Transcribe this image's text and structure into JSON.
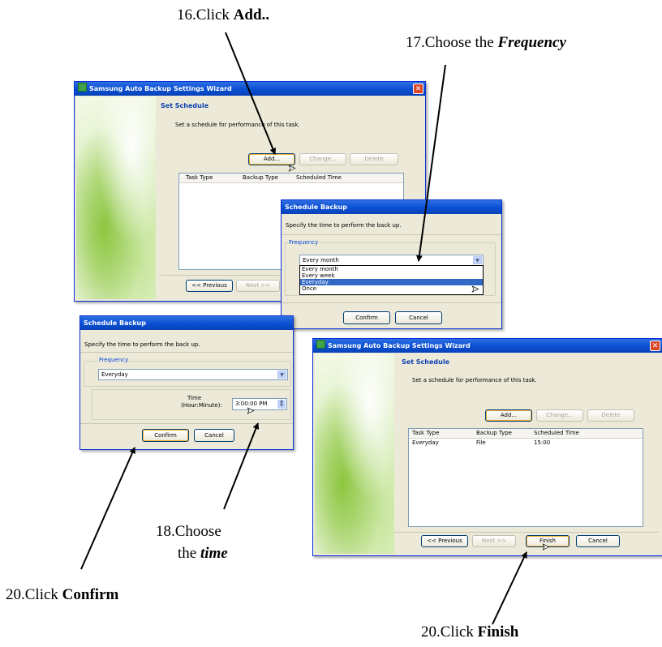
{
  "annotations": {
    "step16": {
      "prefix": "16.Click ",
      "bold": "Add.."
    },
    "step17": {
      "prefix": "17.Choose the ",
      "bold": "Frequency"
    },
    "step18_line1": "18.Choose",
    "step18_line2_prefix": "the ",
    "step18_bold": "time",
    "step20a": {
      "prefix": "20.Click ",
      "bold": "Confirm"
    },
    "step20b": {
      "prefix": "20.Click ",
      "bold": "Finish"
    }
  },
  "wizard1": {
    "title": "Samsung Auto Backup Settings Wizard",
    "heading": "Set Schedule",
    "instruction": "Set a schedule for performance of this task.",
    "buttons": {
      "add": "Add...",
      "change": "Change...",
      "delete": "Delete",
      "previous": "<< Previous",
      "next": "Next >>"
    },
    "columns": [
      "Task Type",
      "Backup Type",
      "Scheduled Time"
    ]
  },
  "schedule1": {
    "title": "Schedule Backup",
    "instruction": "Specify the time to perform the back up.",
    "frequency_label": "Frequency",
    "frequency_value": "Every month",
    "options": [
      "Every month",
      "Every week",
      "Everyday",
      "Once"
    ],
    "selected_option": "Everyday",
    "buttons": {
      "confirm": "Confirm",
      "cancel": "Cancel"
    }
  },
  "schedule2": {
    "title": "Schedule Backup",
    "instruction": "Specify the time to perform the back up.",
    "frequency_label": "Frequency",
    "frequency_value": "Everyday",
    "time_label_1": "Time",
    "time_label_2": "(Hour:Minute):",
    "time_value": "3:00:00 PM",
    "buttons": {
      "confirm": "Confirm",
      "cancel": "Cancel"
    }
  },
  "wizard2": {
    "title": "Samsung Auto Backup Settings Wizard",
    "heading": "Set Schedule",
    "instruction": "Set a schedule for performance of this task.",
    "buttons": {
      "add": "Add...",
      "change": "Change...",
      "delete": "Delete",
      "previous": "<< Previous",
      "next": "Next >>",
      "finish": "Finish",
      "cancel": "Cancel"
    },
    "columns": [
      "Task Type",
      "Backup Type",
      "Scheduled Time"
    ],
    "rows": [
      {
        "task_type": "Everyday",
        "backup_type": "File",
        "scheduled_time": "15:00"
      }
    ]
  },
  "icons": {
    "close": "close-icon",
    "dropdown": "chevron-down-icon",
    "spinner": "spinner-icon",
    "cursor": "mouse-pointer-icon",
    "app": "samsung-app-icon"
  },
  "colors": {
    "titlebar": "#0a4fd2",
    "dialog_bg": "#ece9d8",
    "selection": "#316ac5",
    "heading": "#0a3fb0"
  }
}
